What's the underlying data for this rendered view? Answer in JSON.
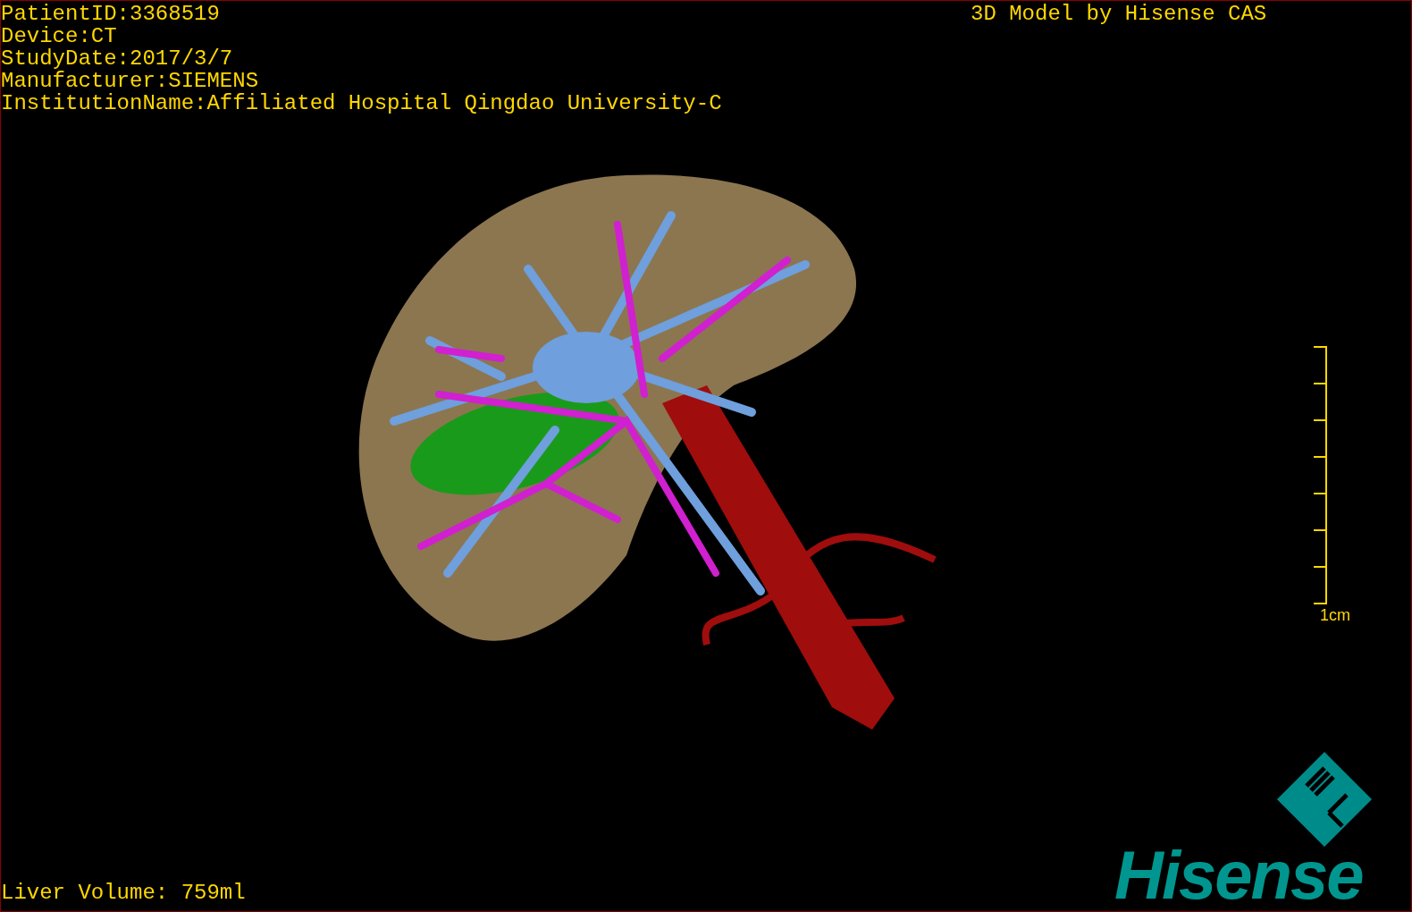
{
  "patient_info": [
    "PatientID:3368519",
    "Device:CT",
    "StudyDate:2017/3/7",
    "Manufacturer:SIEMENS",
    "InstitutionName:Affiliated Hospital Qingdao University-C"
  ],
  "title": "3D Model by Hisense CAS",
  "scale_bar": {
    "label": "1cm"
  },
  "liver_volume": "Liver Volume: 759ml",
  "logo": {
    "text": "Hisense"
  }
}
